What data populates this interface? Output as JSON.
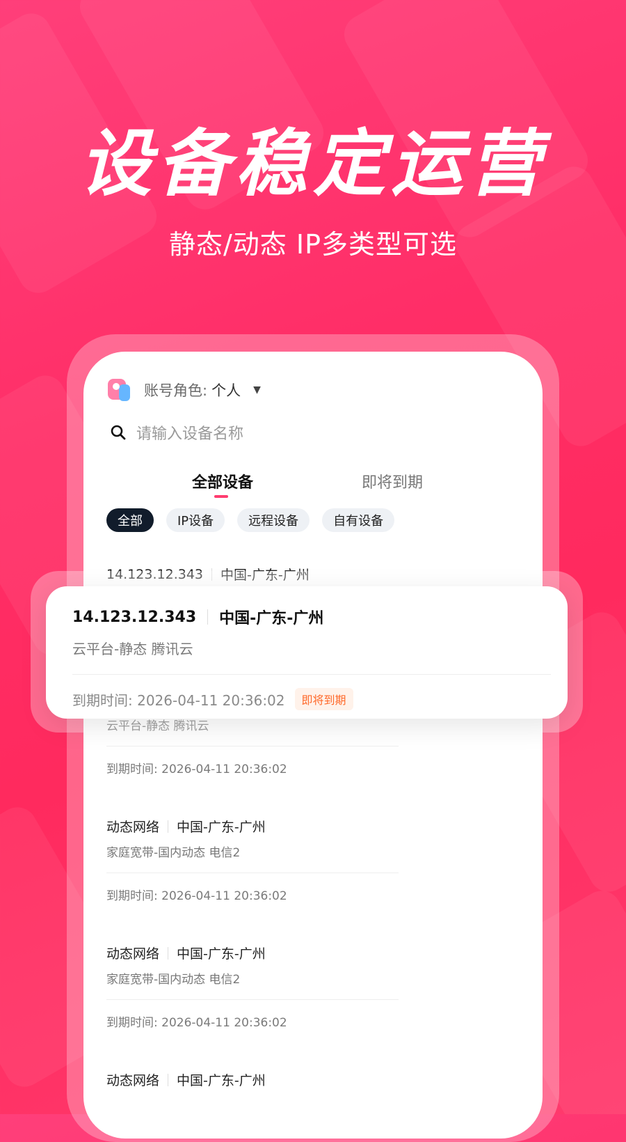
{
  "promo": {
    "headline": "设备稳定运营",
    "subline": "静态/动态 IP多类型可选"
  },
  "account_role": {
    "label": "账号角色:",
    "value": "个人"
  },
  "search": {
    "placeholder": "请输入设备名称"
  },
  "tabs": [
    {
      "label": "全部设备",
      "active": true
    },
    {
      "label": "即将到期",
      "active": false
    }
  ],
  "chips": [
    {
      "label": "全部",
      "active": true
    },
    {
      "label": "IP设备",
      "active": false
    },
    {
      "label": "远程设备",
      "active": false
    },
    {
      "label": "自有设备",
      "active": false
    }
  ],
  "devices": [
    {
      "name": "14.123.12.343",
      "location": "中国-广东-广州",
      "sub": "云平台-静态 腾讯云",
      "expire": "到期时间: 2026-04-11 20:36:02"
    },
    {
      "name": "动态网络",
      "location": "中国-广东-广州",
      "sub": "家庭宽带-国内动态 电信2",
      "expire": "到期时间: 2026-04-11 20:36:02"
    },
    {
      "name": "动态网络",
      "location": "中国-广东-广州",
      "sub": "家庭宽带-国内动态 电信2",
      "expire": "到期时间: 2026-04-11 20:36:02"
    },
    {
      "name": "动态网络",
      "location": "中国-广东-广州",
      "sub": "",
      "expire": ""
    }
  ],
  "highlight": {
    "name": "14.123.12.343",
    "location": "中国-广东-广州",
    "sub": "云平台-静态 腾讯云",
    "expire": "到期时间: 2026-04-11 20:36:02",
    "badge": "即将到期"
  },
  "colors": {
    "brand": "#ff2e67",
    "badge_text": "#ff6a2b",
    "chip_active": "#111c2b"
  }
}
